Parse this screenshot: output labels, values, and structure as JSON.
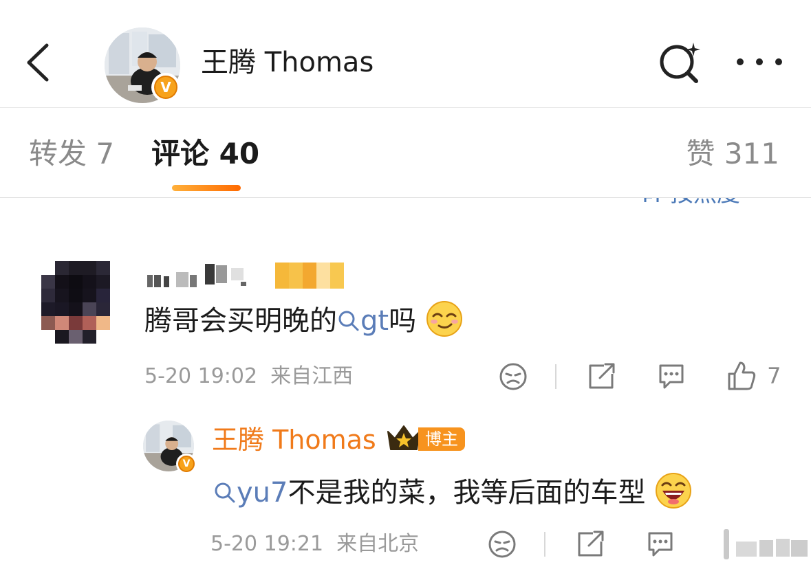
{
  "header": {
    "back_icon": "chevron-left-icon",
    "title": "王腾 Thomas",
    "verified_badge": "V",
    "search_icon": "search-sparkle-icon",
    "more_icon": "ellipsis-icon"
  },
  "tabs": [
    {
      "label": "转发 7",
      "active": false
    },
    {
      "label": "评论 40",
      "active": true
    },
    {
      "label": "赞 311",
      "active": false
    }
  ],
  "sort": {
    "label": "按热度"
  },
  "colors": {
    "accent": "#ff7a1a",
    "link": "#5b7db8",
    "meta": "#9a9a9a"
  },
  "comments": [
    {
      "avatar": "blurred",
      "text_main": "腾哥会买明晚的",
      "link_text": "gt",
      "text_tail": "吗",
      "emoji": "smirk-emoji-icon",
      "time": "5-20 19:02",
      "location": "来自江西",
      "like_count": "7",
      "replies": [
        {
          "author": "王腾 Thomas",
          "owner_badge": "博主",
          "link_text": "yu7",
          "text": "不是我的菜，我等后面的车型",
          "emoji": "laugh-emoji-icon",
          "time": "5-20 19:21",
          "location": "来自北京"
        }
      ]
    }
  ]
}
